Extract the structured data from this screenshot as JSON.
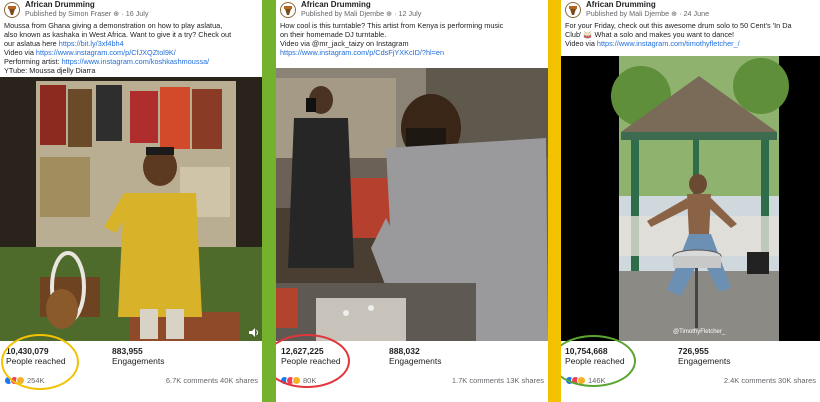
{
  "posts": [
    {
      "page_name": "African Drumming",
      "published_by": "Published by Simon Fraser",
      "date": "16 July",
      "lines": [
        {
          "text": "Moussa from Ghana giving a demonstration on how to play aslatua,"
        },
        {
          "text": "also known as kashaka in West Africa. Want to give it a try? Check out"
        },
        {
          "text": "our aslatua here ",
          "link": "https://bit.ly/3xf4bh4"
        },
        {
          "text": "Video via ",
          "link": "https://www.instagram.com/p/CfJXQZtol9K/"
        },
        {
          "text": "Performing artist: ",
          "link": "https://www.instagram.com/koshkashmoussa/"
        },
        {
          "text": "YTube: Moussa djelly Diarra"
        }
      ],
      "reach_value": "10,430,079",
      "reach_label": "People reached",
      "engagement_value": "883,955",
      "engagement_label": "Engagements",
      "reactions_count": "254K",
      "comments_shares": "6.7K comments  40K shares",
      "highlight_color": "#f2c200"
    },
    {
      "page_name": "African Drumming",
      "published_by": "Published by Mali Djembe",
      "date": "12 July",
      "lines": [
        {
          "text": "How cool is this turntable? This artist from Kenya is performing music"
        },
        {
          "text": "on their homemade DJ turntable."
        },
        {
          "text": "Video via @mr_jack_taizy on Instagram"
        },
        {
          "text": "",
          "link": "https://www.instagram.com/p/CdsFjYXKcID/?hl=en"
        }
      ],
      "reach_value": "12,627,225",
      "reach_label": "People reached",
      "engagement_value": "888,032",
      "engagement_label": "Engagements",
      "reactions_count": "80K",
      "comments_shares": "1.7K comments  13K shares",
      "highlight_color": "#e0363c"
    },
    {
      "page_name": "African Drumming",
      "published_by": "Published by Mali Djembe",
      "date": "24 June",
      "lines": [
        {
          "text": "For your Friday, check out this awesome drum solo to 50 Cent's 'In Da"
        },
        {
          "text": "Club' 🥁 What a solo and makes you want to dance!"
        },
        {
          "text": "Video via ",
          "link": "https://www.instagram.com/timothyfletcher_/"
        }
      ],
      "reach_value": "10,754,668",
      "reach_label": "People reached",
      "engagement_value": "726,955",
      "engagement_label": "Engagements",
      "reactions_count": "146K",
      "comments_shares": "2.4K comments  30K shares",
      "highlight_color": "#5aa532",
      "watermark": "@TimothyFletcher_"
    }
  ],
  "icons": [
    "avatar-drum-logo-icon",
    "globe-icon",
    "volume-icon",
    "like-reaction-icon",
    "love-reaction-icon",
    "wow-reaction-icon"
  ],
  "colors": {
    "divider_green": "#74b12d",
    "divider_yellow": "#f2c200",
    "link": "#216fdb"
  }
}
